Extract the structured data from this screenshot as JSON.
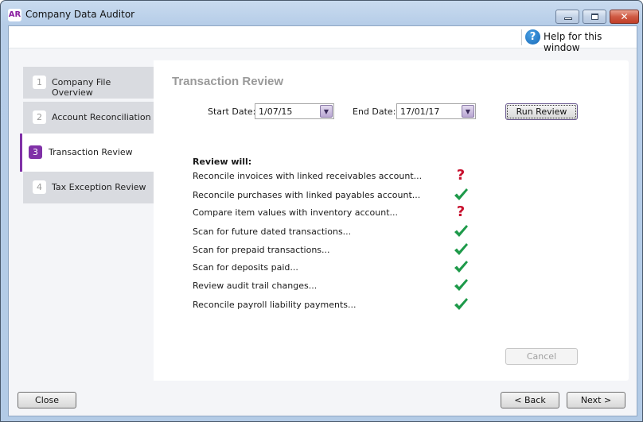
{
  "window": {
    "logo": "AR",
    "title": "Company Data Auditor",
    "controls": {
      "minimize": "minimize",
      "maximize": "maximize",
      "close": "close"
    }
  },
  "help": {
    "icon": "?",
    "label": "Help for this window"
  },
  "steps": [
    {
      "num": "1",
      "label": "Company File Overview",
      "active": false
    },
    {
      "num": "2",
      "label": "Account Reconciliation",
      "active": false
    },
    {
      "num": "3",
      "label": "Transaction Review",
      "active": true
    },
    {
      "num": "4",
      "label": "Tax Exception Review",
      "active": false
    }
  ],
  "panel": {
    "title": "Transaction Review",
    "start_date_label": "Start Date:",
    "start_date": "1/07/15",
    "end_date_label": "End Date:",
    "end_date": "17/01/17",
    "run_button": "Run Review",
    "review_heading": "Review will:",
    "items": [
      {
        "text": "Reconcile invoices with linked receivables account...",
        "status": "question"
      },
      {
        "text": "Reconcile purchases with linked payables account...",
        "status": "check"
      },
      {
        "text": "Compare item values with inventory account...",
        "status": "question"
      },
      {
        "text": "Scan for future dated transactions...",
        "status": "check"
      },
      {
        "text": "Scan for prepaid transactions...",
        "status": "check"
      },
      {
        "text": "Scan for deposits paid...",
        "status": "check"
      },
      {
        "text": "Review audit trail changes...",
        "status": "check"
      },
      {
        "text": "Reconcile payroll liability payments...",
        "status": "check"
      }
    ],
    "cancel_button": "Cancel"
  },
  "footer": {
    "close_button": "Close",
    "back_button": "< Back",
    "next_button": "Next >"
  },
  "colors": {
    "accent": "#8031a7",
    "check": "#1e9a4a",
    "question": "#c8102e",
    "help": "#1669b8"
  }
}
